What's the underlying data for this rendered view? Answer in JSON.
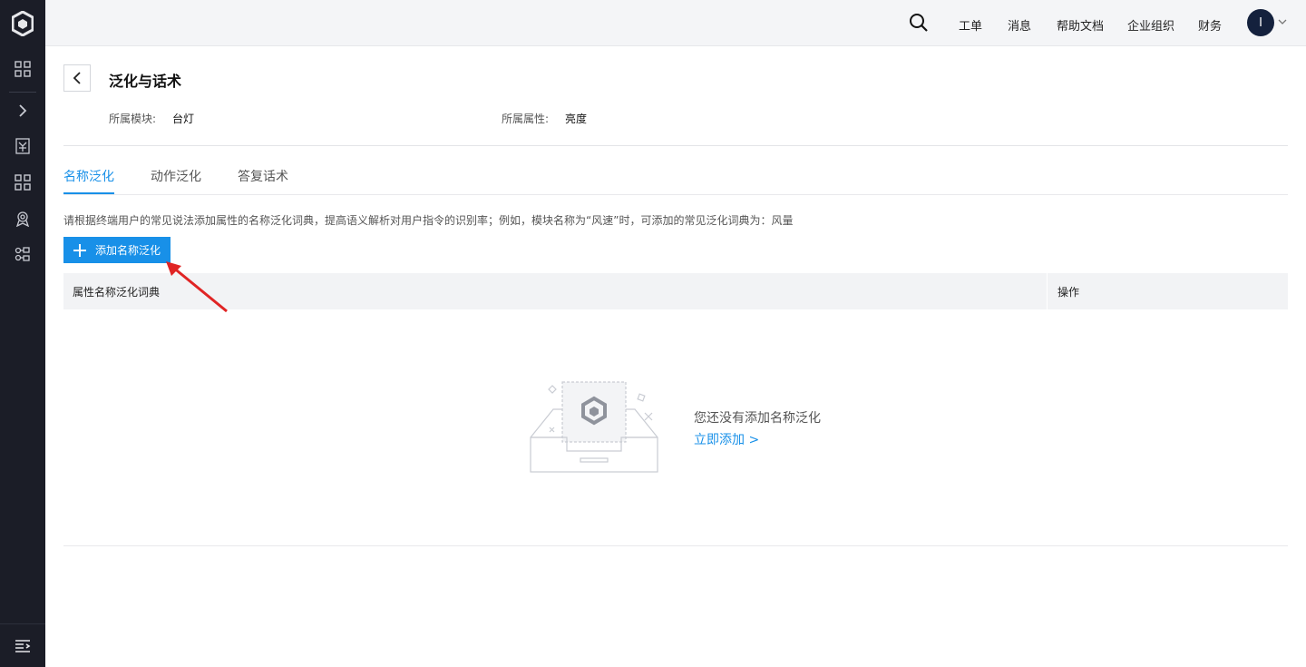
{
  "header": {
    "links": [
      "工单",
      "消息",
      "帮助文档",
      "企业组织",
      "财务"
    ],
    "avatar_initial": "I"
  },
  "page": {
    "title": "泛化与话术",
    "module_label": "所属模块:",
    "module_value": "台灯",
    "property_label": "所属属性:",
    "property_value": "亮度"
  },
  "tabs": [
    {
      "label": "名称泛化",
      "active": true
    },
    {
      "label": "动作泛化",
      "active": false
    },
    {
      "label": "答复话术",
      "active": false
    }
  ],
  "hint": "请根据终端用户的常见说法添加属性的名称泛化词典，提高语义解析对用户指令的识别率；例如，模块名称为“风速”时，可添加的常见泛化词典为：风量",
  "add_button_label": "添加名称泛化",
  "table": {
    "columns": [
      "属性名称泛化词典",
      "操作"
    ]
  },
  "empty_state": {
    "message": "您还没有添加名称泛化",
    "action_label": "立即添加 >"
  },
  "colors": {
    "primary": "#1890e8",
    "sidebar_bg": "#1b1d27",
    "annotation_arrow": "#e02424"
  },
  "icons": {
    "sidebar": [
      "logo-icon",
      "grid-icon",
      "chevron-right-icon",
      "document-icon",
      "apps-icon",
      "badge-icon",
      "flow-icon",
      "collapse-menu-icon"
    ],
    "header": [
      "search-icon",
      "chevron-down-icon"
    ]
  }
}
